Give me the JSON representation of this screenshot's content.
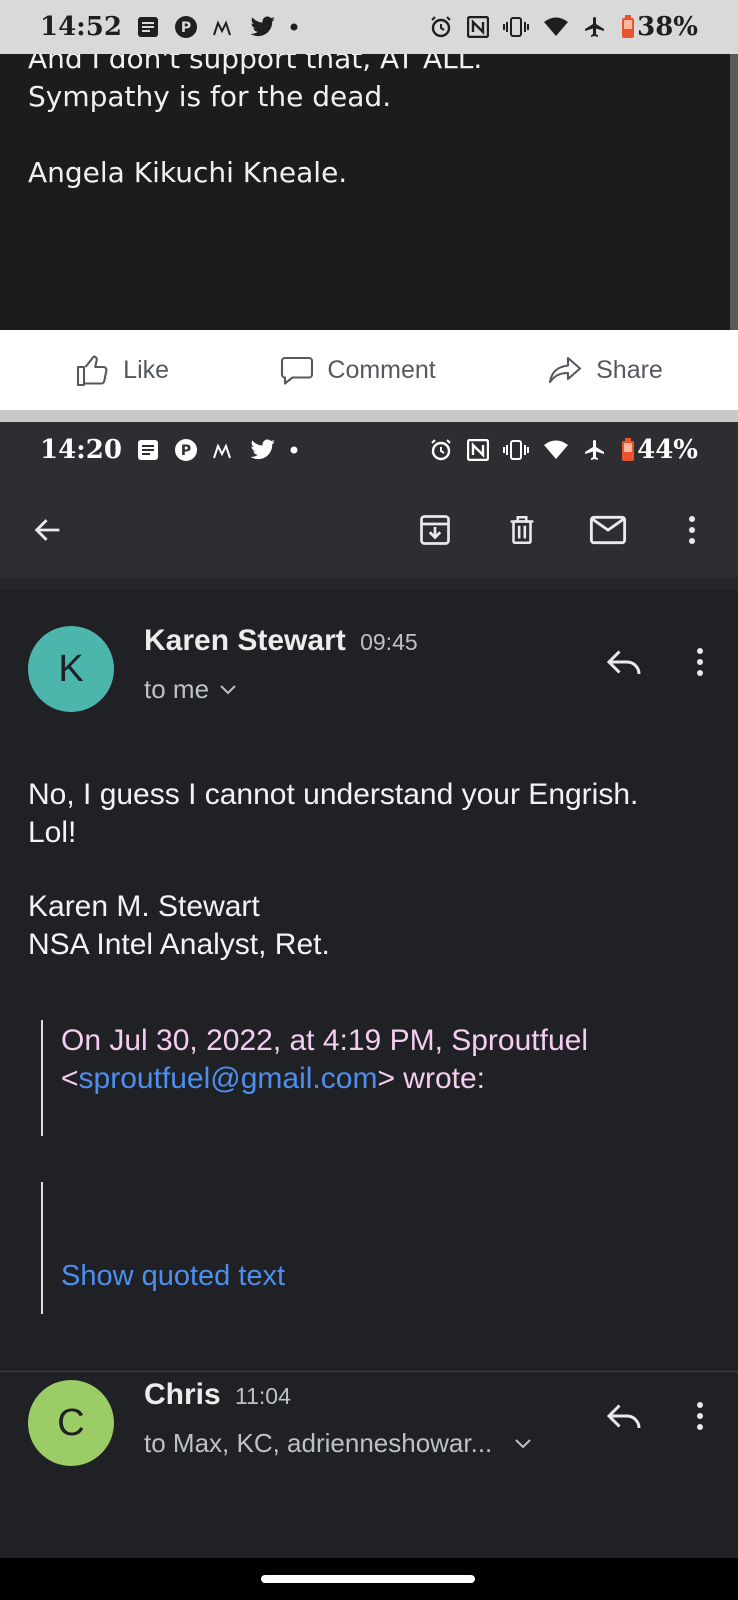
{
  "status_top": {
    "time": "14:52",
    "battery_pct": "38%",
    "notification_icons": [
      "message-icon",
      "pinterest-icon",
      "moto-icon",
      "twitter-icon",
      "dot-icon"
    ],
    "system_icons": [
      "alarm-icon",
      "nfc-icon",
      "vibrate-icon",
      "wifi-icon",
      "airplane-icon",
      "battery-icon"
    ]
  },
  "facebook_post": {
    "line1": "And I don't support that, AT ALL.",
    "line2": "Sympathy is for the dead.",
    "signature": "Angela Kikuchi Kneale.",
    "actions": {
      "like": "Like",
      "comment": "Comment",
      "share": "Share"
    }
  },
  "status_bottom": {
    "time": "14:20",
    "battery_pct": "44%"
  },
  "toolbar": {
    "back": "back-arrow-icon",
    "archive": "archive-icon",
    "delete": "trash-icon",
    "mark_unread": "mail-icon",
    "more": "more-vert-icon"
  },
  "message1": {
    "avatar_letter": "K",
    "avatar_color": "#4db6ac",
    "sender": "Karen Stewart",
    "time": "09:45",
    "recipients": "to me",
    "body_line1": "No, I guess I cannot understand your Engrish.",
    "body_line2": "Lol!",
    "sig_line1": "Karen M. Stewart",
    "sig_line2": "NSA Intel Analyst, Ret.",
    "quote_prefix": "On Jul 30, 2022, at 4:19 PM, Sproutfuel",
    "quote_lt": "<",
    "quote_email": "sproutfuel@gmail.com",
    "quote_suffix": "> wrote:",
    "show_quoted": "Show quoted text"
  },
  "message2": {
    "avatar_letter": "C",
    "avatar_color": "#9ccc65",
    "sender": "Chris",
    "time": "11:04",
    "recipients": "to Max, KC, adrienneshowar..."
  }
}
